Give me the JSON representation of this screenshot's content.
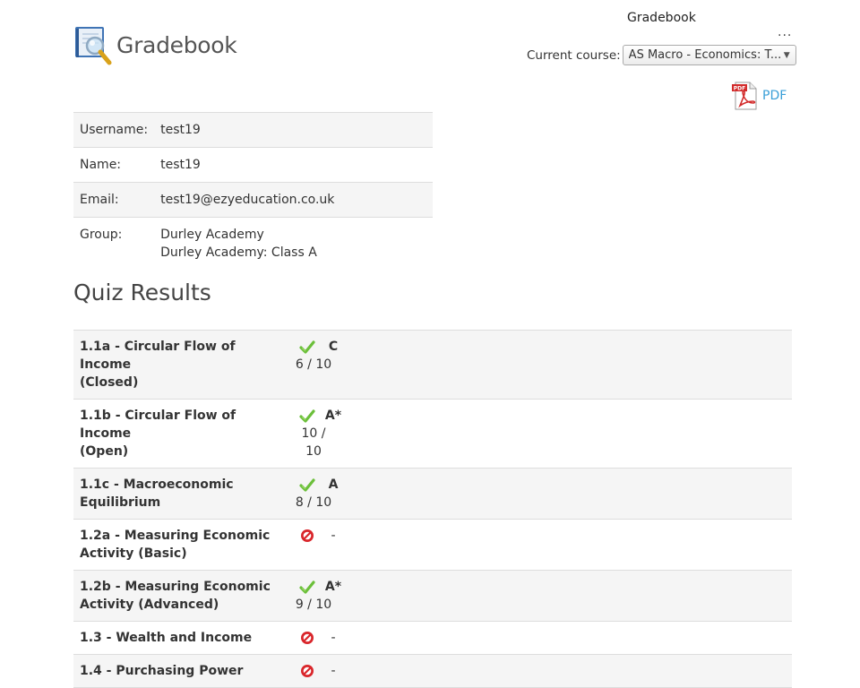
{
  "header": {
    "app_name": "Gradebook",
    "menu_title": "Gradebook",
    "menu_more": "...",
    "course_label": "Current course:",
    "course_value": "AS Macro - Economics: T...",
    "pdf_label": "PDF"
  },
  "user": {
    "username_label": "Username:",
    "username": "test19",
    "name_label": "Name:",
    "name": "test19",
    "email_label": "Email:",
    "email": "test19@ezyeducation.co.uk",
    "group_label": "Group:",
    "groups": [
      "Durley Academy",
      "Durley Academy: Class A"
    ]
  },
  "quiz": {
    "heading": "Quiz Results",
    "rows": [
      {
        "title_line1": "1.1a - Circular Flow of Income",
        "title_line2": "(Closed)",
        "status": "check-icon",
        "grade": "C",
        "score": "6 / 10"
      },
      {
        "title_line1": "1.1b - Circular Flow of Income",
        "title_line2": "(Open)",
        "status": "check-icon",
        "grade": "A*",
        "score": "10 / 10"
      },
      {
        "title_line1": "1.1c - Macroeconomic",
        "title_line2": "Equilibrium",
        "status": "check-icon",
        "grade": "A",
        "score": "8 / 10"
      },
      {
        "title_line1": "1.2a - Measuring Economic",
        "title_line2": "Activity (Basic)",
        "status": "not-attempted-icon",
        "grade": "-",
        "score": ""
      },
      {
        "title_line1": "1.2b - Measuring Economic",
        "title_line2": "Activity (Advanced)",
        "status": "check-icon",
        "grade": "A*",
        "score": "9 / 10"
      },
      {
        "title_line1": "1.3 - Wealth and Income",
        "title_line2": "",
        "status": "not-attempted-icon",
        "grade": "-",
        "score": ""
      },
      {
        "title_line1": "1.4 - Purchasing Power",
        "title_line2": "",
        "status": "not-attempted-icon",
        "grade": "-",
        "score": ""
      }
    ]
  },
  "colors": {
    "link": "#3a9fd8",
    "check": "#6bbf3a",
    "not_attempted": "#d9262b",
    "row_alt": "#f5f5f5"
  }
}
